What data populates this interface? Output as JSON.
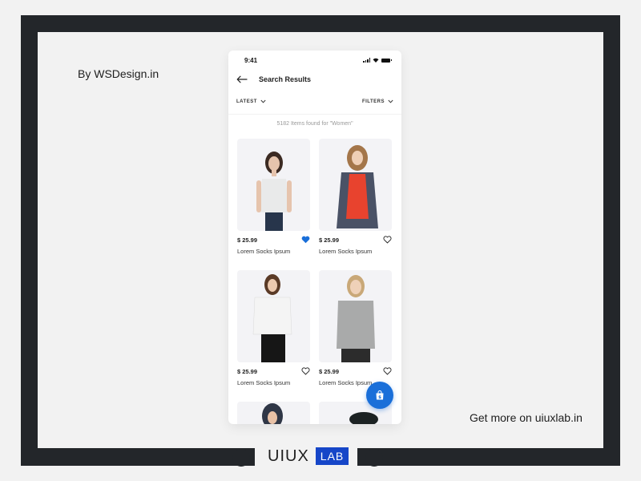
{
  "credit": "By WSDesign.in",
  "get_more": "Get more on uiuxlab.in",
  "logo": {
    "text": "UIUX",
    "badge": "LAB",
    "badge_color": "#1646c8"
  },
  "phone": {
    "status": {
      "time": "9:41"
    },
    "header": {
      "title": "Search Results",
      "back_icon": "arrow-left-icon"
    },
    "filters": {
      "sort_label": "LATEST",
      "filter_label": "FILTERS"
    },
    "result_count": "5182 Items found for \"Women\"",
    "accent": "#1a6fd9",
    "products": [
      {
        "price": "$ 25.99",
        "name": "Lorem Socks Ipsum",
        "favorited": true
      },
      {
        "price": "$ 25.99",
        "name": "Lorem Socks Ipsum",
        "favorited": false
      },
      {
        "price": "$ 25.99",
        "name": "Lorem Socks Ipsum",
        "favorited": false
      },
      {
        "price": "$ 25.99",
        "name": "Lorem Socks Ipsum",
        "favorited": false
      },
      {
        "price": "",
        "name": "",
        "favorited": false
      },
      {
        "price": "",
        "name": "",
        "favorited": false
      }
    ],
    "fab_icon": "shopping-bag-icon"
  }
}
